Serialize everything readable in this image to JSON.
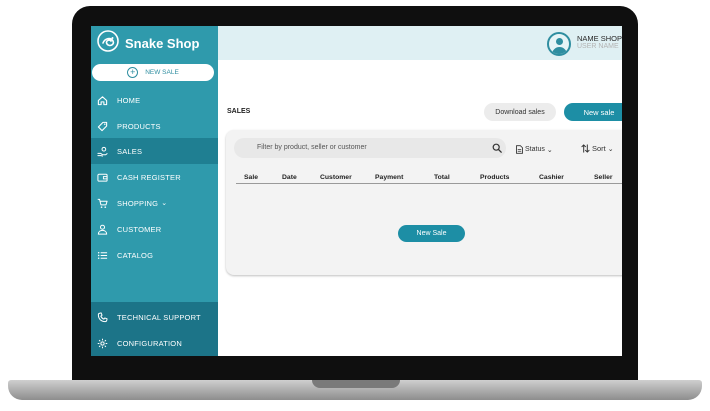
{
  "app": {
    "name": "Snake Shop"
  },
  "sidebar": {
    "new_sale_label": "NEW SALE",
    "items": [
      {
        "label": "HOME",
        "icon": "home-icon"
      },
      {
        "label": "PRODUCTS",
        "icon": "tag-icon"
      },
      {
        "label": "SALES",
        "icon": "hand-coin-icon",
        "active": true
      },
      {
        "label": "CASH REGISTER",
        "icon": "wallet-icon"
      },
      {
        "label": "SHOPPING",
        "icon": "cart-icon",
        "has_dropdown": true
      },
      {
        "label": "CUSTOMER",
        "icon": "user-icon"
      },
      {
        "label": "CATALOG",
        "icon": "list-icon"
      }
    ],
    "bottom_items": [
      {
        "label": "TECHNICAL SUPPORT",
        "icon": "phone-icon"
      },
      {
        "label": "CONFIGURATION",
        "icon": "gear-icon"
      }
    ]
  },
  "header": {
    "shop_name": "NAME SHOP",
    "user_name": "USER NAME"
  },
  "main": {
    "title": "SALES",
    "download_label": "Download sales",
    "new_sale_label": "New sale",
    "search_placeholder": "Filter by product, seller or customer",
    "status_label": "Status",
    "sort_label": "Sort",
    "columns": [
      "Sale",
      "Date",
      "Customer",
      "Payment",
      "Total",
      "Products",
      "Cashier",
      "Seller"
    ],
    "empty_new_sale_label": "New Sale"
  },
  "colors": {
    "sidebar": "#2f9aac",
    "sidebar_active": "#1f7f92",
    "accent": "#1d8ea5",
    "topbar": "#dff0f3"
  }
}
